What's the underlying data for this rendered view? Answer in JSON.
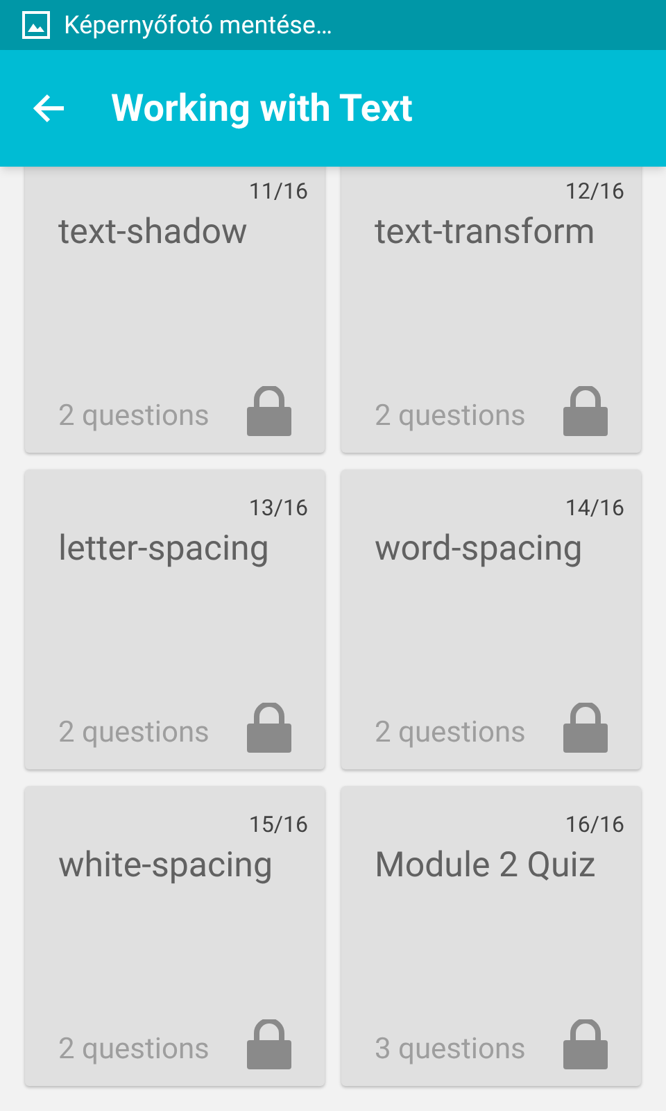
{
  "status_bar": {
    "notification": "Képernyőfotó mentése…"
  },
  "app_bar": {
    "title": "Working with Text"
  },
  "lessons": [
    {
      "counter": "11/16",
      "title": "text-shadow",
      "questions": "2 questions",
      "locked": true
    },
    {
      "counter": "12/16",
      "title": "text-transform",
      "questions": "2 questions",
      "locked": true
    },
    {
      "counter": "13/16",
      "title": "letter-spacing",
      "questions": "2 questions",
      "locked": true
    },
    {
      "counter": "14/16",
      "title": "word-spacing",
      "questions": "2 questions",
      "locked": true
    },
    {
      "counter": "15/16",
      "title": "white-spacing",
      "questions": "2 questions",
      "locked": true
    },
    {
      "counter": "16/16",
      "title": "Module 2 Quiz",
      "questions": "3 questions",
      "locked": true
    }
  ]
}
